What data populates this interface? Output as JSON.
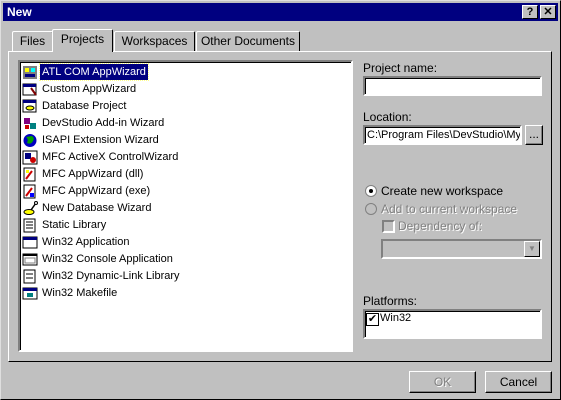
{
  "window": {
    "title": "New",
    "help_label": "?",
    "close_label": "✕"
  },
  "tabs": [
    {
      "label": "Files"
    },
    {
      "label": "Projects"
    },
    {
      "label": "Workspaces"
    },
    {
      "label": "Other Documents"
    }
  ],
  "project_types": [
    {
      "label": "ATL COM AppWizard",
      "icon": "atl-com-icon",
      "selected": true
    },
    {
      "label": "Custom AppWizard",
      "icon": "custom-wizard-icon"
    },
    {
      "label": "Database Project",
      "icon": "database-icon"
    },
    {
      "label": "DevStudio Add-in Wizard",
      "icon": "addin-icon"
    },
    {
      "label": "ISAPI Extension Wizard",
      "icon": "globe-icon"
    },
    {
      "label": "MFC ActiveX ControlWizard",
      "icon": "activex-icon"
    },
    {
      "label": "MFC AppWizard (dll)",
      "icon": "mfc-dll-icon"
    },
    {
      "label": "MFC AppWizard (exe)",
      "icon": "mfc-exe-icon"
    },
    {
      "label": "New Database Wizard",
      "icon": "db-wizard-icon"
    },
    {
      "label": "Static Library",
      "icon": "static-lib-icon"
    },
    {
      "label": "Win32 Application",
      "icon": "win32-app-icon"
    },
    {
      "label": "Win32 Console Application",
      "icon": "console-icon"
    },
    {
      "label": "Win32 Dynamic-Link Library",
      "icon": "dll-icon"
    },
    {
      "label": "Win32 Makefile",
      "icon": "makefile-icon"
    }
  ],
  "project_name": {
    "label": "Project name:",
    "value": ""
  },
  "location": {
    "label": "Location:",
    "value": "C:\\Program Files\\DevStudio\\My",
    "browse_label": "..."
  },
  "workspace": {
    "create_label": "Create new workspace",
    "add_label": "Add to current workspace",
    "dependency_label": "Dependency of:",
    "dependency_value": ""
  },
  "platforms": {
    "label": "Platforms:",
    "items": [
      {
        "label": "Win32",
        "checked": true
      }
    ]
  },
  "buttons": {
    "ok": "OK",
    "cancel": "Cancel"
  }
}
